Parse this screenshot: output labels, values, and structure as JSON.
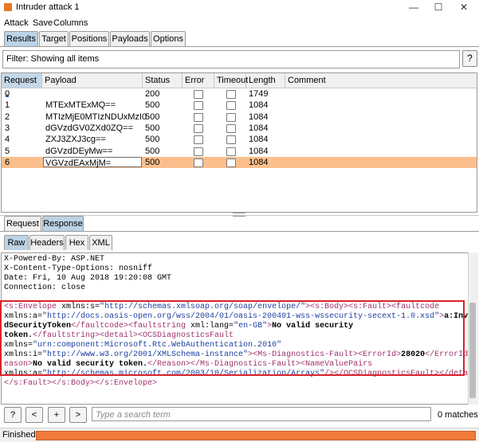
{
  "window": {
    "title": "Intruder attack 1",
    "minimize": "—",
    "maximize": "☐",
    "close": "✕"
  },
  "menu": [
    "Attack",
    "Save",
    "Columns"
  ],
  "tabs": [
    "Results",
    "Target",
    "Positions",
    "Payloads",
    "Options"
  ],
  "filter": {
    "text": "Filter: Showing all items",
    "help": "?"
  },
  "table": {
    "columns": [
      "Request",
      "Payload",
      "Status",
      "Error",
      "Timeout",
      "Length",
      "Comment"
    ],
    "sort_indicator": "▲",
    "rows": [
      {
        "request": "0",
        "payload": "",
        "status": "200",
        "length": "1749"
      },
      {
        "request": "1",
        "payload": "MTExMTExMQ==",
        "status": "500",
        "length": "1084"
      },
      {
        "request": "2",
        "payload": "MTIzMjE0MTIzNDUxMzI0",
        "status": "500",
        "length": "1084"
      },
      {
        "request": "3",
        "payload": "dGVzdGV0ZXd0ZQ==",
        "status": "500",
        "length": "1084"
      },
      {
        "request": "4",
        "payload": "ZXJ3ZXJ3cg==",
        "status": "500",
        "length": "1084"
      },
      {
        "request": "5",
        "payload": "dGVzdDEyMw==",
        "status": "500",
        "length": "1084"
      },
      {
        "request": "6",
        "payload": "VGVzdEAxMjM=",
        "status": "500",
        "length": "1084"
      }
    ],
    "selected_row": 6
  },
  "req_tabs": [
    "Request",
    "Response"
  ],
  "sub_tabs": [
    "Raw",
    "Headers",
    "Hex",
    "XML"
  ],
  "response": {
    "headers": [
      "X-Powered-By: ASP.NET",
      "X-Content-Type-Options: nosniff",
      "Date: Fri, 10 Aug 2018 19:20:08 GMT",
      "Connection: close"
    ],
    "l1a": "<s:Envelope",
    "l1b": " xmlns:s=",
    "l1c": "\"http://schemas.xmlsoap.org/soap/envelope/\"",
    "l1d": "><s:Body><s:Fault><faultcode",
    "l2a": "xmlns:a=",
    "l2b": "\"http://docs.oasis-open.org/wss/2004/01/oasis-200401-wss-wssecurity-secext-1.0.xsd\"",
    "l2c": ">",
    "l2d": "a:Invali",
    "l3a": "dSecurityToken",
    "l3b": "</faultcode><faultstring",
    "l3c": " xml:lang=",
    "l3d": "\"en-GB\"",
    "l3e": ">",
    "l3f": "No valid security",
    "l4a": "token.",
    "l4b": "</faultstring><detail><OCSDiagnosticsFault",
    "l5a": "xmlns=",
    "l5b": "\"urn:component:Microsoft.Rtc.WebAuthentication.2010\"",
    "l6a": "xmlns:i=",
    "l6b": "\"http://www.w3.org/2001/XMLSchema-instance\"",
    "l6c": "><Ms-Diagnostics-Fault><ErrorId>",
    "l6d": "28020",
    "l6e": "</ErrorId><R",
    "l7a": "eason>",
    "l7b": "No valid security token.",
    "l7c": "</Reason></Ms-Diagnostics-Fault><NameValuePairs",
    "l8a": "xmlns:a=",
    "l8b": "\"http://schemas.microsoft.com/2003/10/Serialization/Arrays\"",
    "l8c": "/></OCSDiagnosticsFault></detail>",
    "l9a": "</s:Fault></s:Body></s:Envelope>"
  },
  "search": {
    "help": "?",
    "prev": "<",
    "plus": "+",
    "next": ">",
    "placeholder": "Type a search term",
    "matches": "0 matches"
  },
  "status": {
    "text": "Finished"
  },
  "colors": {
    "accent": "#f07a3a",
    "selected_row": "#fbbf8e",
    "highlight_box": "#d8232a",
    "active_tab": "#bcd3e6"
  }
}
